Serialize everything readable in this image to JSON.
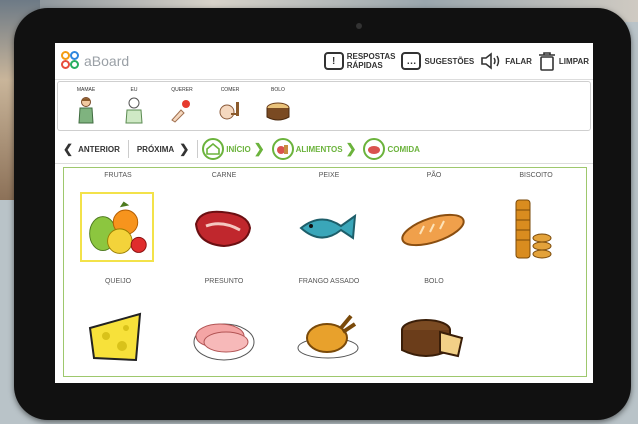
{
  "app": {
    "name": "aBoard"
  },
  "toolbar": {
    "quick_line1": "RESPOSTAS",
    "quick_line2": "RÁPIDAS",
    "suggestions": "SUGESTÕES",
    "speak": "FALAR",
    "clear": "LIMPAR"
  },
  "sentence_strip": [
    {
      "label": "MAMAE"
    },
    {
      "label": "EU"
    },
    {
      "label": "QUERER"
    },
    {
      "label": "COMER"
    },
    {
      "label": "BOLO"
    }
  ],
  "nav": {
    "prev": "ANTERIOR",
    "next": "PRÓXIMA",
    "crumbs": [
      "INÍCIO",
      "ALIMENTOS",
      "COMIDA"
    ]
  },
  "items": [
    {
      "label": "FRUTAS",
      "icon": "fruits-icon",
      "selected": true
    },
    {
      "label": "CARNE",
      "icon": "meat-icon"
    },
    {
      "label": "PEIXE",
      "icon": "fish-icon"
    },
    {
      "label": "PÃO",
      "icon": "bread-icon"
    },
    {
      "label": "BISCOITO",
      "icon": "cookies-icon"
    },
    {
      "label": "QUEIJO",
      "icon": "cheese-icon"
    },
    {
      "label": "PRESUNTO",
      "icon": "ham-icon"
    },
    {
      "label": "FRANGO ASSADO",
      "icon": "roast-chicken-icon"
    },
    {
      "label": "BOLO",
      "icon": "cake-icon"
    }
  ],
  "colors": {
    "accent_green": "#6bb33c",
    "selected_border": "#f3e24a"
  }
}
